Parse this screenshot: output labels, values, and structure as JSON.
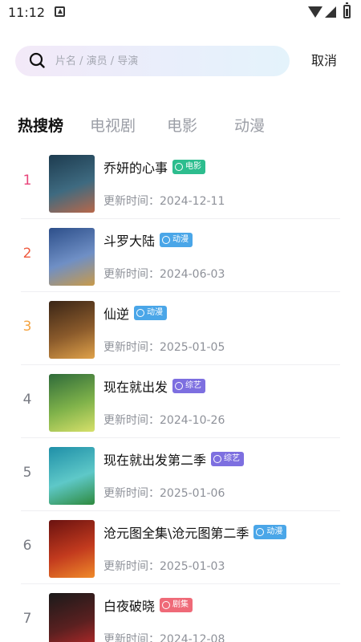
{
  "status_bar": {
    "time": "11:12"
  },
  "search": {
    "placeholder": "片名 / 演员 / 导演",
    "cancel_label": "取消"
  },
  "tabs": [
    {
      "label": "热搜榜",
      "active": true
    },
    {
      "label": "电视剧",
      "active": false
    },
    {
      "label": "电影",
      "active": false
    },
    {
      "label": "动漫",
      "active": false
    }
  ],
  "updated_prefix": "更新时间：",
  "items": [
    {
      "rank": "1",
      "rank_color": "#e8447a",
      "title": "乔妍的心事",
      "badge": "电影",
      "badge_color": "#2dbd8e",
      "date": "2024-12-11",
      "poster_colors": [
        "#1d3b4f",
        "#3e6a80",
        "#b8684a"
      ]
    },
    {
      "rank": "2",
      "rank_color": "#ef5a3f",
      "title": "斗罗大陆",
      "badge": "动漫",
      "badge_color": "#4aa6e8",
      "date": "2024-06-03",
      "poster_colors": [
        "#2d4f8a",
        "#6f8fc5",
        "#c89a4a"
      ]
    },
    {
      "rank": "3",
      "rank_color": "#f4a442",
      "title": "仙逆",
      "badge": "动漫",
      "badge_color": "#4aa6e8",
      "date": "2025-01-05",
      "poster_colors": [
        "#3a2516",
        "#8a5a2b",
        "#e0a24a"
      ]
    },
    {
      "rank": "4",
      "rank_color": "#777a82",
      "title": "现在就出发",
      "badge": "综艺",
      "badge_color": "#7d6fe0",
      "date": "2024-10-26",
      "poster_colors": [
        "#2f6b3a",
        "#7fb24a",
        "#d7e06a"
      ]
    },
    {
      "rank": "5",
      "rank_color": "#777a82",
      "title": "现在就出发第二季",
      "badge": "综艺",
      "badge_color": "#7d6fe0",
      "date": "2025-01-06",
      "poster_colors": [
        "#1f8fa8",
        "#5ec8c8",
        "#2e8a3e"
      ]
    },
    {
      "rank": "6",
      "rank_color": "#777a82",
      "title": "沧元图全集\\沧元图第二季",
      "badge": "动漫",
      "badge_color": "#4aa6e8",
      "date": "2025-01-03",
      "poster_colors": [
        "#6a1210",
        "#c23a1e",
        "#f08a2a"
      ]
    },
    {
      "rank": "7",
      "rank_color": "#777a82",
      "title": "白夜破晓",
      "badge": "剧集",
      "badge_color": "#ef6a78",
      "date": "2024-12-08",
      "poster_colors": [
        "#1a1a1a",
        "#5a2020",
        "#c02a2a"
      ]
    }
  ]
}
